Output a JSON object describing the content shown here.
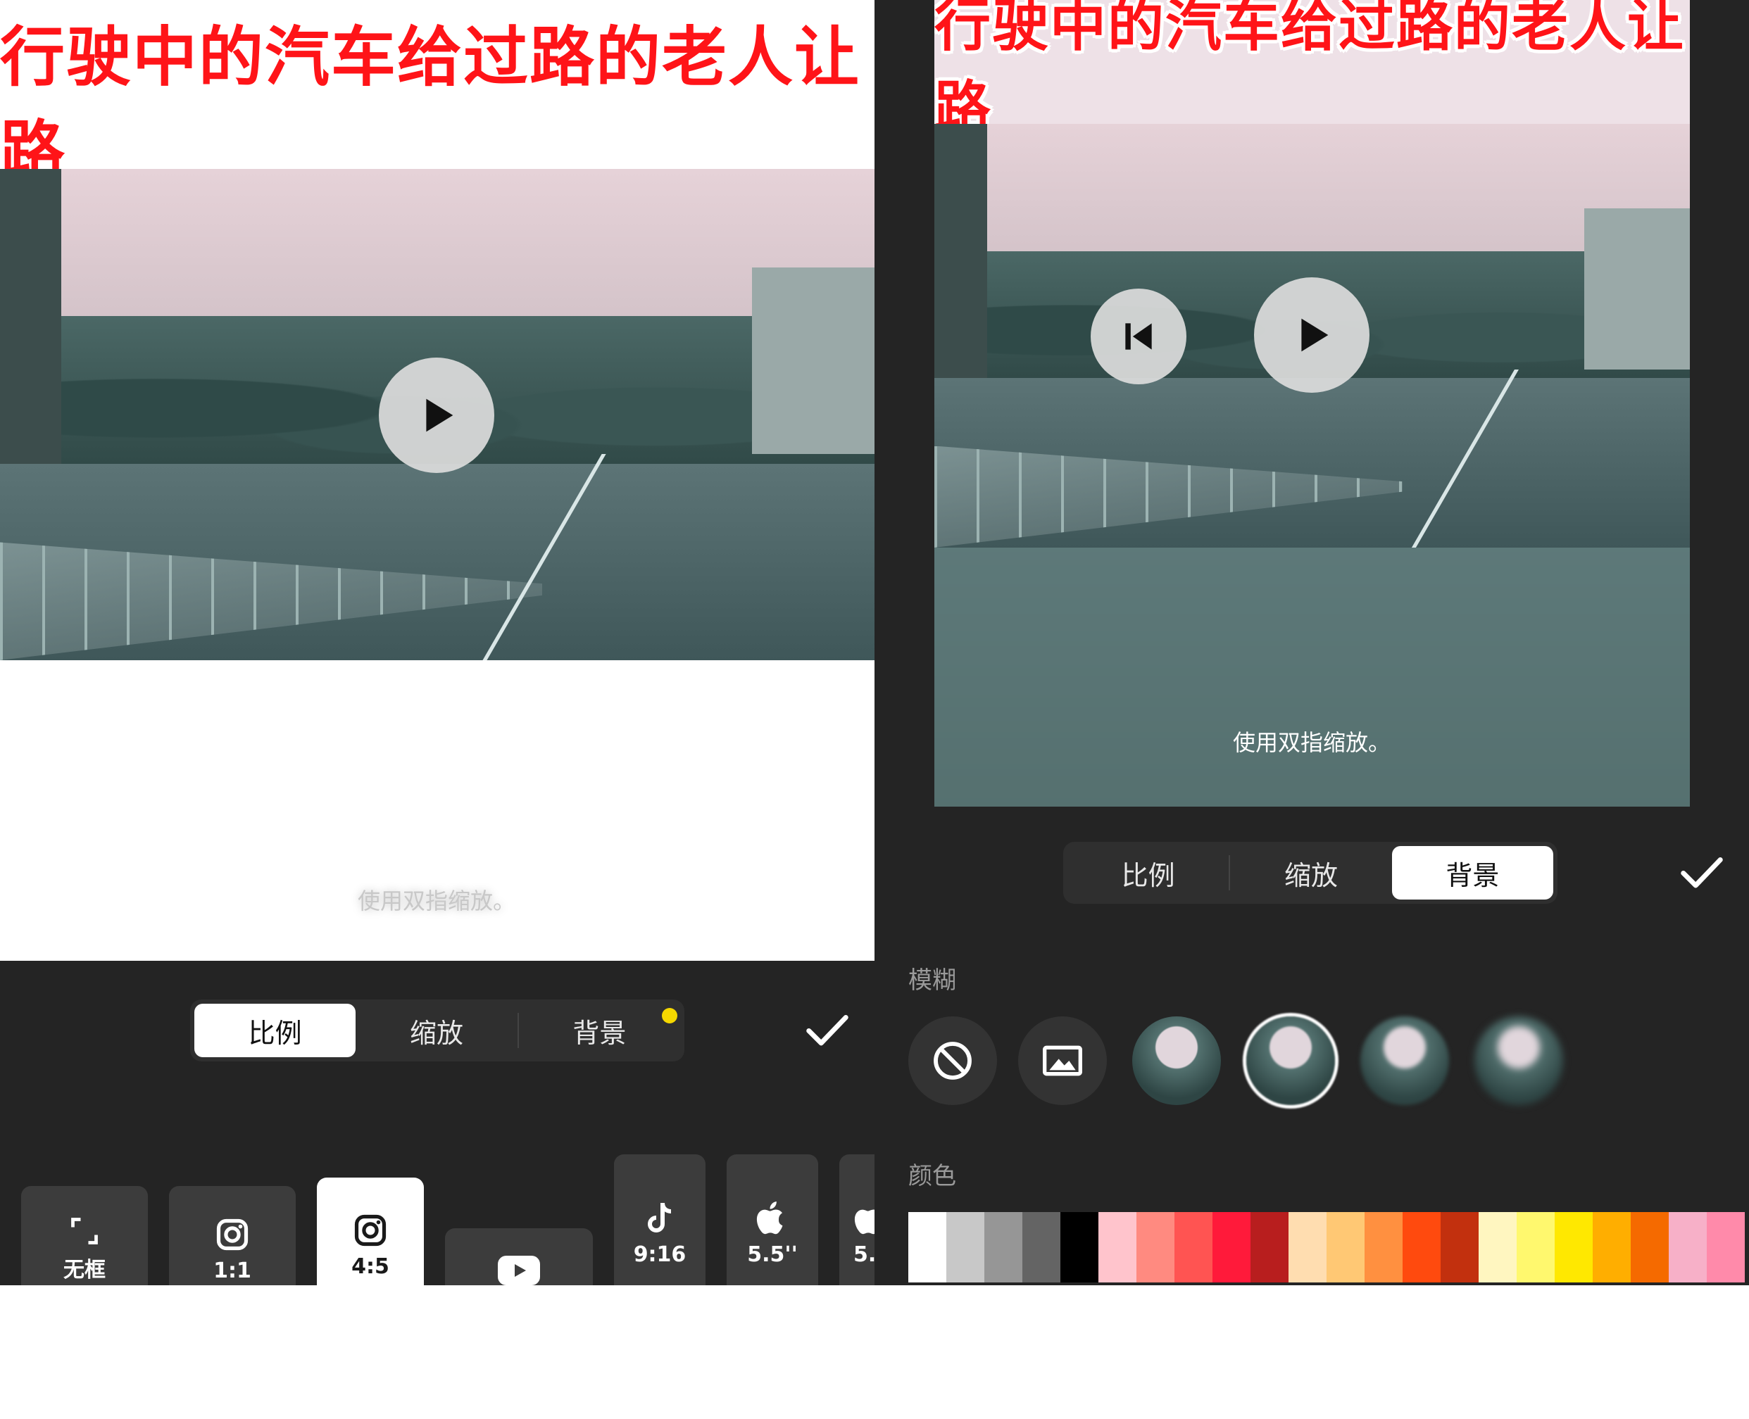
{
  "left": {
    "title": "行驶中的汽车给过路的老人让路",
    "hint": "使用双指缩放。",
    "tabs": [
      "比例",
      "缩放",
      "背景"
    ],
    "active_tab": "比例",
    "ratio_options": [
      {
        "label": "无框",
        "icon": "expand-icon"
      },
      {
        "label": "1:1",
        "icon": "instagram-icon"
      },
      {
        "label": "4:5",
        "icon": "instagram-icon"
      },
      {
        "label": "",
        "icon": "youtube-icon"
      },
      {
        "label": "9:16",
        "icon": "tiktok-icon"
      },
      {
        "label": "5.5''",
        "icon": "apple-icon"
      },
      {
        "label": "5.",
        "icon": "apple-icon"
      }
    ],
    "selected_ratio": "4:5"
  },
  "right": {
    "title": "行驶中的汽车给过路的老人让路",
    "hint": "使用双指缩放。",
    "tabs": [
      "比例",
      "缩放",
      "背景"
    ],
    "active_tab": "背景",
    "blur_label": "模糊",
    "color_label": "颜色",
    "color_swatches": [
      "#ffffff",
      "#c8c8c8",
      "#969696",
      "#646464",
      "#000000",
      "#ffc4cc",
      "#ff8a80",
      "#ff5452",
      "#ff1a3a",
      "#b81e1e",
      "#ffddb0",
      "#ffc874",
      "#ff9040",
      "#ff4a0e",
      "#c2300e",
      "#fff6c0",
      "#fff86e",
      "#ffe800",
      "#ffae00",
      "#f56a00",
      "#f7b0c8",
      "#ff8aaa"
    ]
  },
  "colors": {
    "title_red": "#ff1418",
    "toolbar_bg": "#242424",
    "accent_yellow": "#f5d800"
  }
}
